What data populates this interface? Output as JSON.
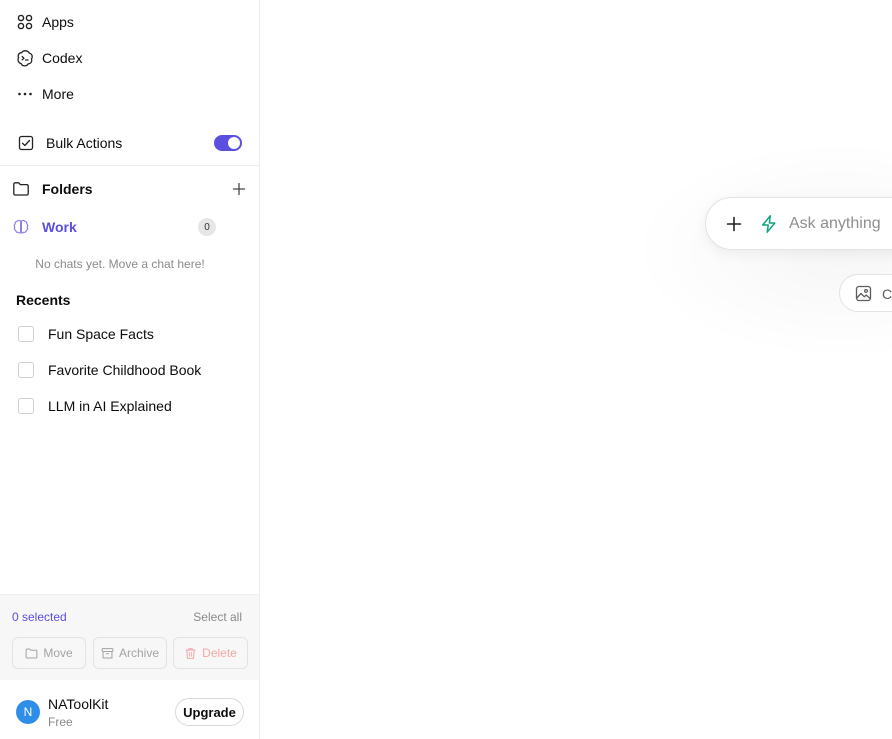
{
  "sidebar": {
    "nav": [
      {
        "label": "Apps",
        "icon": "apps-grid-icon"
      },
      {
        "label": "Codex",
        "icon": "codex-icon"
      },
      {
        "label": "More",
        "icon": "more-dots-icon"
      }
    ],
    "bulk_actions": {
      "label": "Bulk Actions",
      "enabled": true
    },
    "folders": {
      "label": "Folders"
    },
    "work_folder": {
      "label": "Work",
      "count": "0",
      "empty_note": "No chats yet. Move a chat here!"
    },
    "recents": {
      "title": "Recents",
      "items": [
        "Fun Space Facts",
        "Favorite Childhood Book",
        "LLM in AI Explained"
      ]
    },
    "bulk_footer": {
      "selected": "0 selected",
      "select_all": "Select all",
      "move": "Move",
      "archive": "Archive",
      "delete": "Delete"
    },
    "user": {
      "initial": "N",
      "name": "NAToolKit",
      "plan": "Free",
      "upgrade": "Upgrade"
    }
  },
  "main": {
    "composer": {
      "placeholder": "Ask anything"
    },
    "chip": {
      "label": "Cr"
    }
  },
  "colors": {
    "accent": "#5b4fe0",
    "bolt": "#10a37f",
    "avatar": "#2f8fe8",
    "delete": "#f3a8a8"
  }
}
